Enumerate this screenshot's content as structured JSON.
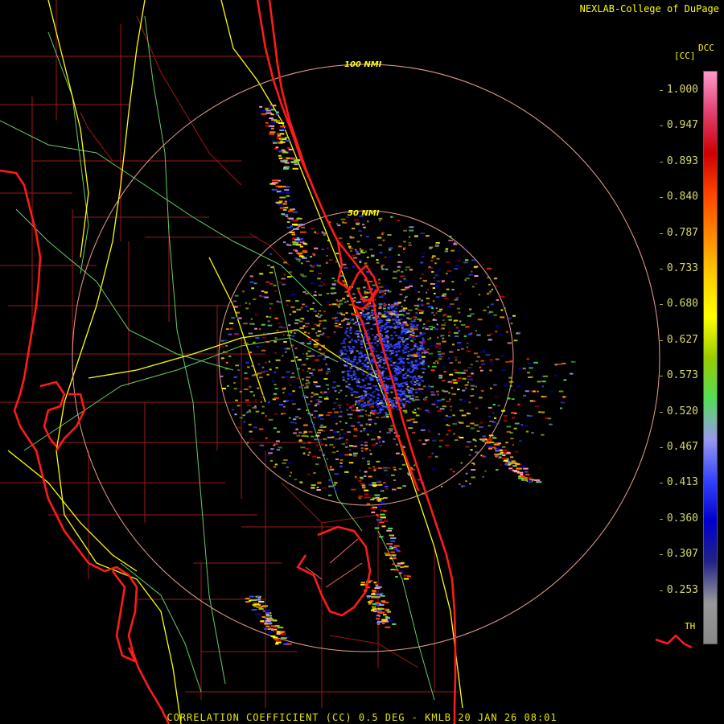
{
  "header": {
    "credit": "NEXLAB-College of DuPage"
  },
  "footer": {
    "product_line": "CORRELATION COEFFICIENT (CC) 0.5 DEG - KMLB 20 JAN 26 08:01"
  },
  "range_rings": [
    {
      "label": "100 NMI",
      "range_nmi": 100
    },
    {
      "label": "50 NMI",
      "range_nmi": 50
    }
  ],
  "legend": {
    "product_code": "DCC",
    "unit": "[CC]",
    "ticks": [
      "1.000",
      "0.947",
      "0.893",
      "0.840",
      "0.787",
      "0.733",
      "0.680",
      "0.627",
      "0.573",
      "0.520",
      "0.467",
      "0.413",
      "0.360",
      "0.307",
      "0.253"
    ],
    "threshold_label": "TH"
  },
  "colors": {
    "coastline": "#ff1a1a",
    "county_lines": "#a01818",
    "highways": "#ffff00",
    "roads": "#66cc66",
    "range_ring": "#e8a090",
    "text": "#ffff00",
    "scale_stops": [
      "#ff99cc",
      "#e04070",
      "#cc0000",
      "#ff4400",
      "#ff8800",
      "#ffcc00",
      "#ffff00",
      "#99cc00",
      "#55dd55",
      "#9999ee",
      "#3344ff",
      "#0000cc",
      "#222288",
      "#999999",
      "#888888"
    ]
  }
}
